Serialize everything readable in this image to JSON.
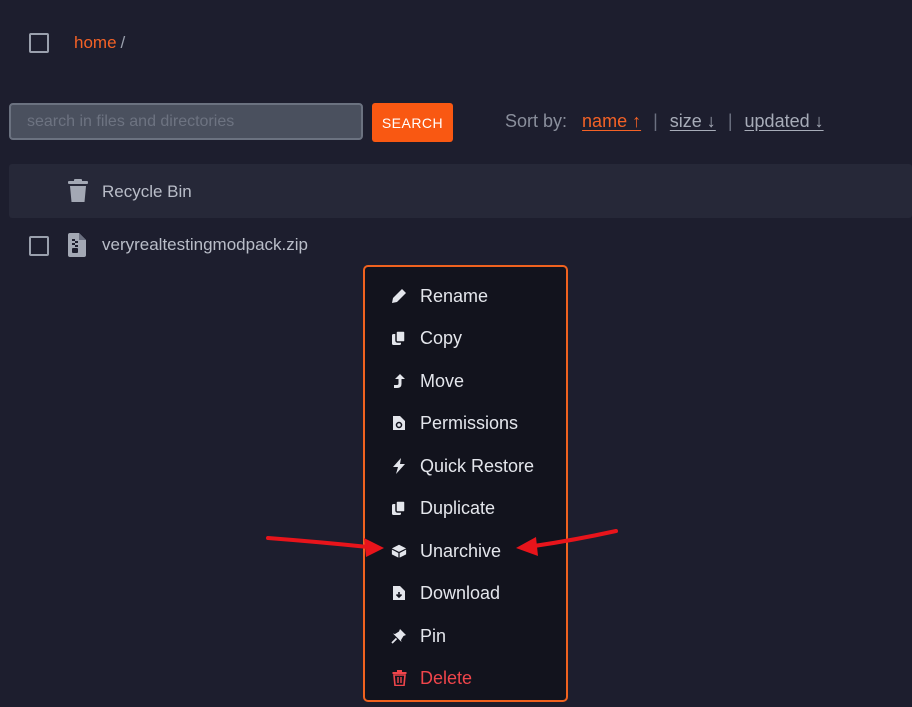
{
  "breadcrumb": {
    "home": "home",
    "separator": "/"
  },
  "search": {
    "placeholder": "search in files and directories",
    "value": "",
    "button_label": "SEARCH"
  },
  "sort": {
    "label": "Sort by:",
    "options": [
      {
        "label": "name ↑",
        "active": true
      },
      {
        "label": "size ↓",
        "active": false
      },
      {
        "label": "updated ↓",
        "active": false
      }
    ],
    "separator": "|"
  },
  "files": [
    {
      "name": "Recycle Bin",
      "icon": "trash-icon"
    },
    {
      "name": "veryrealtestingmodpack.zip",
      "icon": "file-archive-icon"
    }
  ],
  "context_menu": {
    "items": [
      {
        "label": "Rename",
        "icon": "pencil-icon"
      },
      {
        "label": "Copy",
        "icon": "copy-icon"
      },
      {
        "label": "Move",
        "icon": "move-arrow-icon"
      },
      {
        "label": "Permissions",
        "icon": "file-permissions-icon"
      },
      {
        "label": "Quick Restore",
        "icon": "bolt-icon"
      },
      {
        "label": "Duplicate",
        "icon": "duplicate-icon"
      },
      {
        "label": "Unarchive",
        "icon": "box-open-icon"
      },
      {
        "label": "Download",
        "icon": "file-download-icon"
      },
      {
        "label": "Pin",
        "icon": "pin-icon"
      },
      {
        "label": "Delete",
        "icon": "trash-icon"
      }
    ]
  },
  "colors": {
    "background": "#1d1e2e",
    "accent": "#f95812",
    "menu_border": "#f0621f",
    "danger": "#f0454b",
    "annotation_arrow": "#e8141b"
  }
}
